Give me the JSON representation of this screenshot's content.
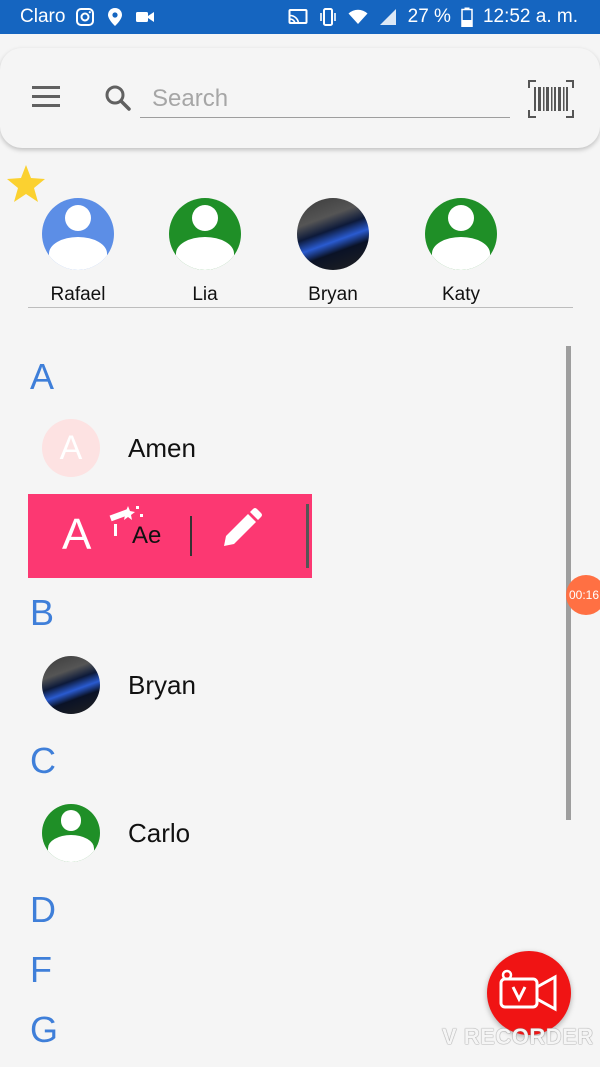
{
  "status_bar": {
    "carrier": "Claro",
    "battery": "27 %",
    "time": "12:52 a. m."
  },
  "search": {
    "placeholder": "Search"
  },
  "favorites": [
    {
      "name": "Rafael",
      "avatar": "generic-person-blue"
    },
    {
      "name": "Lia",
      "avatar": "generic-person-green"
    },
    {
      "name": "Bryan",
      "avatar": "photo"
    },
    {
      "name": "Katy",
      "avatar": "generic-person-green"
    }
  ],
  "sections": [
    {
      "letter": "A",
      "contacts": [
        {
          "name": "Amen",
          "avatar": "letter",
          "avatar_letter": "A"
        }
      ]
    },
    {
      "letter": "B",
      "contacts": [
        {
          "name": "Bryan",
          "avatar": "photo"
        }
      ]
    },
    {
      "letter": "C",
      "contacts": [
        {
          "name": "Carlo",
          "avatar": "generic-person-green"
        }
      ]
    },
    {
      "letter": "D",
      "contacts": []
    },
    {
      "letter": "F",
      "contacts": []
    },
    {
      "letter": "G",
      "contacts": []
    }
  ],
  "editing_row": {
    "avatar_letter": "A",
    "value": "Ae"
  },
  "overlays": {
    "timer": "00:16",
    "watermark": "V RECORDER"
  },
  "colors": {
    "status_bar": "#1565c0",
    "accent_letter": "#3f7fd9",
    "edit_row": "#fc3872",
    "generic_avatar_green": "#1f8f27",
    "generic_avatar_blue": "#5c8ee6",
    "recorder_button": "#f01414"
  }
}
